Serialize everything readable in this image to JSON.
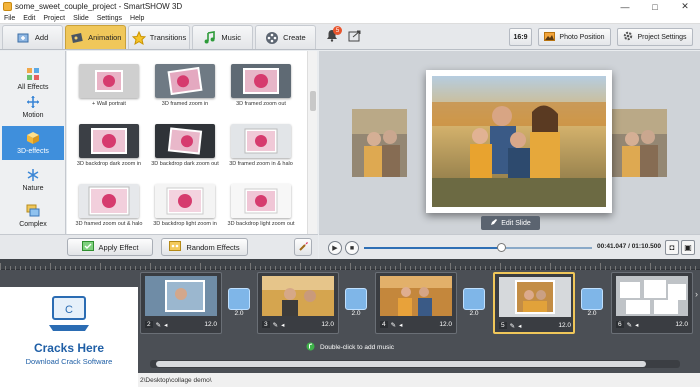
{
  "window": {
    "title": "some_sweet_couple_project - SmartSHOW 3D",
    "controls": [
      "—",
      "□",
      "✕"
    ]
  },
  "menu": [
    "File",
    "Edit",
    "Project",
    "Slide",
    "Settings",
    "Help"
  ],
  "tabs": [
    {
      "label": "Add",
      "icon": "add-slide-icon"
    },
    {
      "label": "Animation",
      "icon": "animation-icon",
      "active": true
    },
    {
      "label": "Transitions",
      "icon": "star-icon"
    },
    {
      "label": "Music",
      "icon": "music-note-icon"
    },
    {
      "label": "Create",
      "icon": "film-reel-icon"
    }
  ],
  "toolbar": {
    "notification_count": "5",
    "aspect": "16:9",
    "photo_position": "Photo Position",
    "project_settings": "Project Settings"
  },
  "categories": [
    {
      "label": "All Effects",
      "icon": "grid-icon"
    },
    {
      "label": "Motion",
      "icon": "move-arrows-icon"
    },
    {
      "label": "3D-effects",
      "icon": "cube-icon",
      "active": true
    },
    {
      "label": "Nature",
      "icon": "snowflake-icon"
    },
    {
      "label": "Complex",
      "icon": "layers-icon"
    }
  ],
  "effects": [
    {
      "label": "+ Wall portrait"
    },
    {
      "label": "3D framed zoom in"
    },
    {
      "label": "3D framed zoom out"
    },
    {
      "label": "3D backdrop dark zoom in"
    },
    {
      "label": "3D backdrop dark zoom out"
    },
    {
      "label": "3D framed zoom in & halo"
    },
    {
      "label": "3D framed zoom out & halo"
    },
    {
      "label": "3D backdrop light zoom in"
    },
    {
      "label": "3D backdrop light zoom out"
    }
  ],
  "effect_buttons": {
    "apply": "Apply Effect",
    "random": "Random Effects"
  },
  "preview": {
    "edit_slide": "Edit Slide"
  },
  "player": {
    "time": "00:41.047 / 01:10.500",
    "progress": 0.6
  },
  "timeline": {
    "slides": [
      {
        "num": "2",
        "dur": "12.0"
      },
      {
        "num": "3",
        "dur": "12.0"
      },
      {
        "num": "4",
        "dur": "12.0"
      },
      {
        "num": "5",
        "dur": "12.0",
        "selected": true
      },
      {
        "num": "6",
        "dur": "12.0"
      }
    ],
    "transitions": [
      "2.0",
      "2.0",
      "2.0",
      "2.0",
      "2.0"
    ],
    "music_hint": "Double-click to add music"
  },
  "status": {
    "path": "2\\Desktop\\collage demo\\"
  },
  "watermark": {
    "title": "Cracks Here",
    "subtitle": "Download Crack Software"
  }
}
